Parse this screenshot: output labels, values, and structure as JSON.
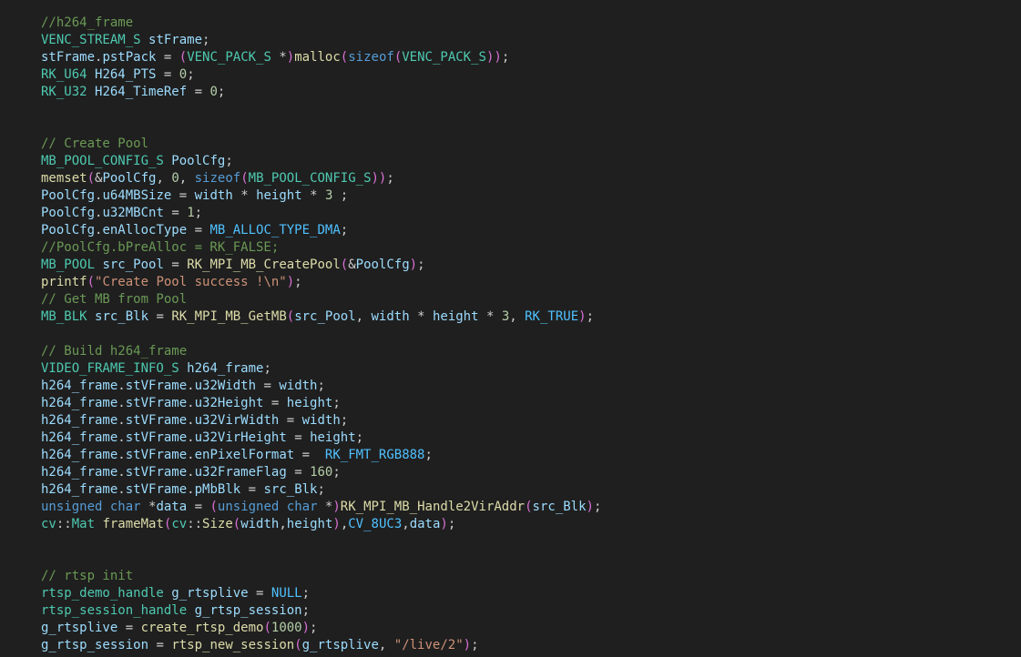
{
  "editor": {
    "language": "c",
    "theme_colors": {
      "background": "#1f1f1f",
      "default_text": "#cccccc",
      "comment": "#6a9955",
      "type": "#4ec9b0",
      "variable": "#9cdcfe",
      "function": "#dcdcaa",
      "number": "#b5cea8",
      "string": "#ce9178",
      "keyword": "#569cd6",
      "constant": "#4fc1ff",
      "paren": "#da70d6"
    },
    "lines": [
      [
        [
          "comment",
          "//h264_frame"
        ]
      ],
      [
        [
          "type",
          "VENC_STREAM_S"
        ],
        [
          "punct",
          " "
        ],
        [
          "var",
          "stFrame"
        ],
        [
          "punct",
          ";"
        ]
      ],
      [
        [
          "var",
          "stFrame"
        ],
        [
          "punct",
          "."
        ],
        [
          "var",
          "pstPack"
        ],
        [
          "punct",
          " = "
        ],
        [
          "paren",
          "("
        ],
        [
          "type",
          "VENC_PACK_S"
        ],
        [
          "punct",
          " *"
        ],
        [
          "paren",
          ")"
        ],
        [
          "func",
          "malloc"
        ],
        [
          "paren",
          "("
        ],
        [
          "kw",
          "sizeof"
        ],
        [
          "paren",
          "("
        ],
        [
          "type",
          "VENC_PACK_S"
        ],
        [
          "paren",
          "))"
        ],
        [
          "punct",
          ";"
        ]
      ],
      [
        [
          "type",
          "RK_U64"
        ],
        [
          "punct",
          " "
        ],
        [
          "var",
          "H264_PTS"
        ],
        [
          "punct",
          " = "
        ],
        [
          "num",
          "0"
        ],
        [
          "punct",
          ";"
        ]
      ],
      [
        [
          "type",
          "RK_U32"
        ],
        [
          "punct",
          " "
        ],
        [
          "var",
          "H264_TimeRef"
        ],
        [
          "punct",
          " = "
        ],
        [
          "num",
          "0"
        ],
        [
          "punct",
          ";"
        ]
      ],
      [],
      [],
      [
        [
          "comment",
          "// Create Pool"
        ]
      ],
      [
        [
          "type",
          "MB_POOL_CONFIG_S"
        ],
        [
          "punct",
          " "
        ],
        [
          "var",
          "PoolCfg"
        ],
        [
          "punct",
          ";"
        ]
      ],
      [
        [
          "func",
          "memset"
        ],
        [
          "paren",
          "("
        ],
        [
          "punct",
          "&"
        ],
        [
          "var",
          "PoolCfg"
        ],
        [
          "punct",
          ", "
        ],
        [
          "num",
          "0"
        ],
        [
          "punct",
          ", "
        ],
        [
          "kw",
          "sizeof"
        ],
        [
          "paren",
          "("
        ],
        [
          "type",
          "MB_POOL_CONFIG_S"
        ],
        [
          "paren",
          "))"
        ],
        [
          "punct",
          ";"
        ]
      ],
      [
        [
          "var",
          "PoolCfg"
        ],
        [
          "punct",
          "."
        ],
        [
          "var",
          "u64MBSize"
        ],
        [
          "punct",
          " = "
        ],
        [
          "var",
          "width"
        ],
        [
          "punct",
          " * "
        ],
        [
          "var",
          "height"
        ],
        [
          "punct",
          " * "
        ],
        [
          "num",
          "3"
        ],
        [
          "punct",
          " ;"
        ]
      ],
      [
        [
          "var",
          "PoolCfg"
        ],
        [
          "punct",
          "."
        ],
        [
          "var",
          "u32MBCnt"
        ],
        [
          "punct",
          " = "
        ],
        [
          "num",
          "1"
        ],
        [
          "punct",
          ";"
        ]
      ],
      [
        [
          "var",
          "PoolCfg"
        ],
        [
          "punct",
          "."
        ],
        [
          "var",
          "enAllocType"
        ],
        [
          "punct",
          " = "
        ],
        [
          "const",
          "MB_ALLOC_TYPE_DMA"
        ],
        [
          "punct",
          ";"
        ]
      ],
      [
        [
          "comment",
          "//PoolCfg.bPreAlloc = RK_FALSE;"
        ]
      ],
      [
        [
          "type",
          "MB_POOL"
        ],
        [
          "punct",
          " "
        ],
        [
          "var",
          "src_Pool"
        ],
        [
          "punct",
          " = "
        ],
        [
          "func",
          "RK_MPI_MB_CreatePool"
        ],
        [
          "paren",
          "("
        ],
        [
          "punct",
          "&"
        ],
        [
          "var",
          "PoolCfg"
        ],
        [
          "paren",
          ")"
        ],
        [
          "punct",
          ";"
        ]
      ],
      [
        [
          "func",
          "printf"
        ],
        [
          "paren",
          "("
        ],
        [
          "str",
          "\"Create Pool success !\\n\""
        ],
        [
          "paren",
          ")"
        ],
        [
          "punct",
          ";"
        ]
      ],
      [
        [
          "comment",
          "// Get MB from Pool"
        ]
      ],
      [
        [
          "type",
          "MB_BLK"
        ],
        [
          "punct",
          " "
        ],
        [
          "var",
          "src_Blk"
        ],
        [
          "punct",
          " = "
        ],
        [
          "func",
          "RK_MPI_MB_GetMB"
        ],
        [
          "paren",
          "("
        ],
        [
          "var",
          "src_Pool"
        ],
        [
          "punct",
          ", "
        ],
        [
          "var",
          "width"
        ],
        [
          "punct",
          " * "
        ],
        [
          "var",
          "height"
        ],
        [
          "punct",
          " * "
        ],
        [
          "num",
          "3"
        ],
        [
          "punct",
          ", "
        ],
        [
          "const",
          "RK_TRUE"
        ],
        [
          "paren",
          ")"
        ],
        [
          "punct",
          ";"
        ]
      ],
      [],
      [
        [
          "comment",
          "// Build h264_frame"
        ]
      ],
      [
        [
          "type",
          "VIDEO_FRAME_INFO_S"
        ],
        [
          "punct",
          " "
        ],
        [
          "var",
          "h264_frame"
        ],
        [
          "punct",
          ";"
        ]
      ],
      [
        [
          "var",
          "h264_frame"
        ],
        [
          "punct",
          "."
        ],
        [
          "var",
          "stVFrame"
        ],
        [
          "punct",
          "."
        ],
        [
          "var",
          "u32Width"
        ],
        [
          "punct",
          " = "
        ],
        [
          "var",
          "width"
        ],
        [
          "punct",
          ";"
        ]
      ],
      [
        [
          "var",
          "h264_frame"
        ],
        [
          "punct",
          "."
        ],
        [
          "var",
          "stVFrame"
        ],
        [
          "punct",
          "."
        ],
        [
          "var",
          "u32Height"
        ],
        [
          "punct",
          " = "
        ],
        [
          "var",
          "height"
        ],
        [
          "punct",
          ";"
        ]
      ],
      [
        [
          "var",
          "h264_frame"
        ],
        [
          "punct",
          "."
        ],
        [
          "var",
          "stVFrame"
        ],
        [
          "punct",
          "."
        ],
        [
          "var",
          "u32VirWidth"
        ],
        [
          "punct",
          " = "
        ],
        [
          "var",
          "width"
        ],
        [
          "punct",
          ";"
        ]
      ],
      [
        [
          "var",
          "h264_frame"
        ],
        [
          "punct",
          "."
        ],
        [
          "var",
          "stVFrame"
        ],
        [
          "punct",
          "."
        ],
        [
          "var",
          "u32VirHeight"
        ],
        [
          "punct",
          " = "
        ],
        [
          "var",
          "height"
        ],
        [
          "punct",
          ";"
        ]
      ],
      [
        [
          "var",
          "h264_frame"
        ],
        [
          "punct",
          "."
        ],
        [
          "var",
          "stVFrame"
        ],
        [
          "punct",
          "."
        ],
        [
          "var",
          "enPixelFormat"
        ],
        [
          "punct",
          " =  "
        ],
        [
          "const",
          "RK_FMT_RGB888"
        ],
        [
          "punct",
          ";"
        ]
      ],
      [
        [
          "var",
          "h264_frame"
        ],
        [
          "punct",
          "."
        ],
        [
          "var",
          "stVFrame"
        ],
        [
          "punct",
          "."
        ],
        [
          "var",
          "u32FrameFlag"
        ],
        [
          "punct",
          " = "
        ],
        [
          "num",
          "160"
        ],
        [
          "punct",
          ";"
        ]
      ],
      [
        [
          "var",
          "h264_frame"
        ],
        [
          "punct",
          "."
        ],
        [
          "var",
          "stVFrame"
        ],
        [
          "punct",
          "."
        ],
        [
          "var",
          "pMbBlk"
        ],
        [
          "punct",
          " = "
        ],
        [
          "var",
          "src_Blk"
        ],
        [
          "punct",
          ";"
        ]
      ],
      [
        [
          "kw",
          "unsigned"
        ],
        [
          "punct",
          " "
        ],
        [
          "kw",
          "char"
        ],
        [
          "punct",
          " *"
        ],
        [
          "var",
          "data"
        ],
        [
          "punct",
          " = "
        ],
        [
          "paren",
          "("
        ],
        [
          "kw",
          "unsigned"
        ],
        [
          "punct",
          " "
        ],
        [
          "kw",
          "char"
        ],
        [
          "punct",
          " *"
        ],
        [
          "paren",
          ")"
        ],
        [
          "func",
          "RK_MPI_MB_Handle2VirAddr"
        ],
        [
          "paren",
          "("
        ],
        [
          "var",
          "src_Blk"
        ],
        [
          "paren",
          ")"
        ],
        [
          "punct",
          ";"
        ]
      ],
      [
        [
          "ns",
          "cv"
        ],
        [
          "punct",
          "::"
        ],
        [
          "type",
          "Mat"
        ],
        [
          "punct",
          " "
        ],
        [
          "func",
          "frameMat"
        ],
        [
          "paren",
          "("
        ],
        [
          "ns",
          "cv"
        ],
        [
          "punct",
          "::"
        ],
        [
          "func",
          "Size"
        ],
        [
          "paren",
          "("
        ],
        [
          "var",
          "width"
        ],
        [
          "punct",
          ","
        ],
        [
          "var",
          "height"
        ],
        [
          "paren",
          ")"
        ],
        [
          "punct",
          ","
        ],
        [
          "const",
          "CV_8UC3"
        ],
        [
          "punct",
          ","
        ],
        [
          "var",
          "data"
        ],
        [
          "paren",
          ")"
        ],
        [
          "punct",
          ";"
        ]
      ],
      [],
      [],
      [
        [
          "comment",
          "// rtsp init"
        ]
      ],
      [
        [
          "type",
          "rtsp_demo_handle"
        ],
        [
          "punct",
          " "
        ],
        [
          "var",
          "g_rtsplive"
        ],
        [
          "punct",
          " = "
        ],
        [
          "const",
          "NULL"
        ],
        [
          "punct",
          ";"
        ]
      ],
      [
        [
          "type",
          "rtsp_session_handle"
        ],
        [
          "punct",
          " "
        ],
        [
          "var",
          "g_rtsp_session"
        ],
        [
          "punct",
          ";"
        ]
      ],
      [
        [
          "var",
          "g_rtsplive"
        ],
        [
          "punct",
          " = "
        ],
        [
          "func",
          "create_rtsp_demo"
        ],
        [
          "paren",
          "("
        ],
        [
          "num",
          "1000"
        ],
        [
          "paren",
          ")"
        ],
        [
          "punct",
          ";"
        ]
      ],
      [
        [
          "var",
          "g_rtsp_session"
        ],
        [
          "punct",
          " = "
        ],
        [
          "func",
          "rtsp_new_session"
        ],
        [
          "paren",
          "("
        ],
        [
          "var",
          "g_rtsplive"
        ],
        [
          "punct",
          ", "
        ],
        [
          "str",
          "\"/live/2\""
        ],
        [
          "paren",
          ")"
        ],
        [
          "punct",
          ";"
        ]
      ]
    ]
  }
}
